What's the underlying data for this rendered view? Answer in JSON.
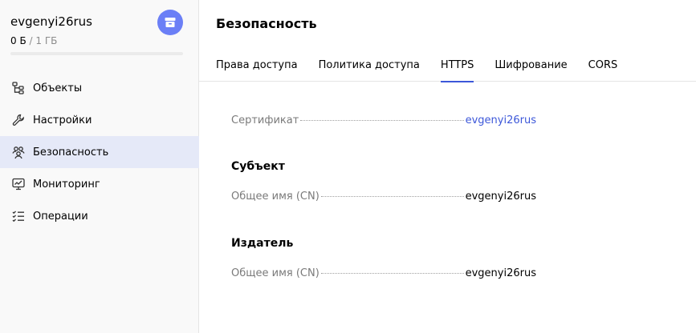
{
  "sidebar": {
    "bucket_name": "evgenyi26rus",
    "usage_used": "0 Б",
    "usage_total": "1 ГБ",
    "usage_fraction": 0.0,
    "icons": {
      "bucket": "bucket-icon"
    },
    "items": [
      {
        "label": "Объекты",
        "icon": "objects-tree-icon"
      },
      {
        "label": "Настройки",
        "icon": "wrench-icon"
      },
      {
        "label": "Безопасность",
        "icon": "users-icon"
      },
      {
        "label": "Мониторинг",
        "icon": "monitor-chart-icon"
      },
      {
        "label": "Операции",
        "icon": "checklist-icon"
      }
    ],
    "active_index": 2
  },
  "main": {
    "title": "Безопасность",
    "tabs": [
      {
        "label": "Права доступа"
      },
      {
        "label": "Политика доступа"
      },
      {
        "label": "HTTPS"
      },
      {
        "label": "Шифрование"
      },
      {
        "label": "CORS"
      }
    ],
    "active_tab": 2,
    "certificate": {
      "label": "Сертификат",
      "value": "evgenyi26rus"
    },
    "subject": {
      "title": "Субъект",
      "cn_label": "Общее имя (CN)",
      "cn_value": "evgenyi26rus"
    },
    "issuer": {
      "title": "Издатель",
      "cn_label": "Общее имя (CN)",
      "cn_value": "evgenyi26rus"
    }
  },
  "colors": {
    "accent": "#6b7ff6",
    "link": "#3c57d9",
    "active_bg": "#e5e9f8"
  }
}
